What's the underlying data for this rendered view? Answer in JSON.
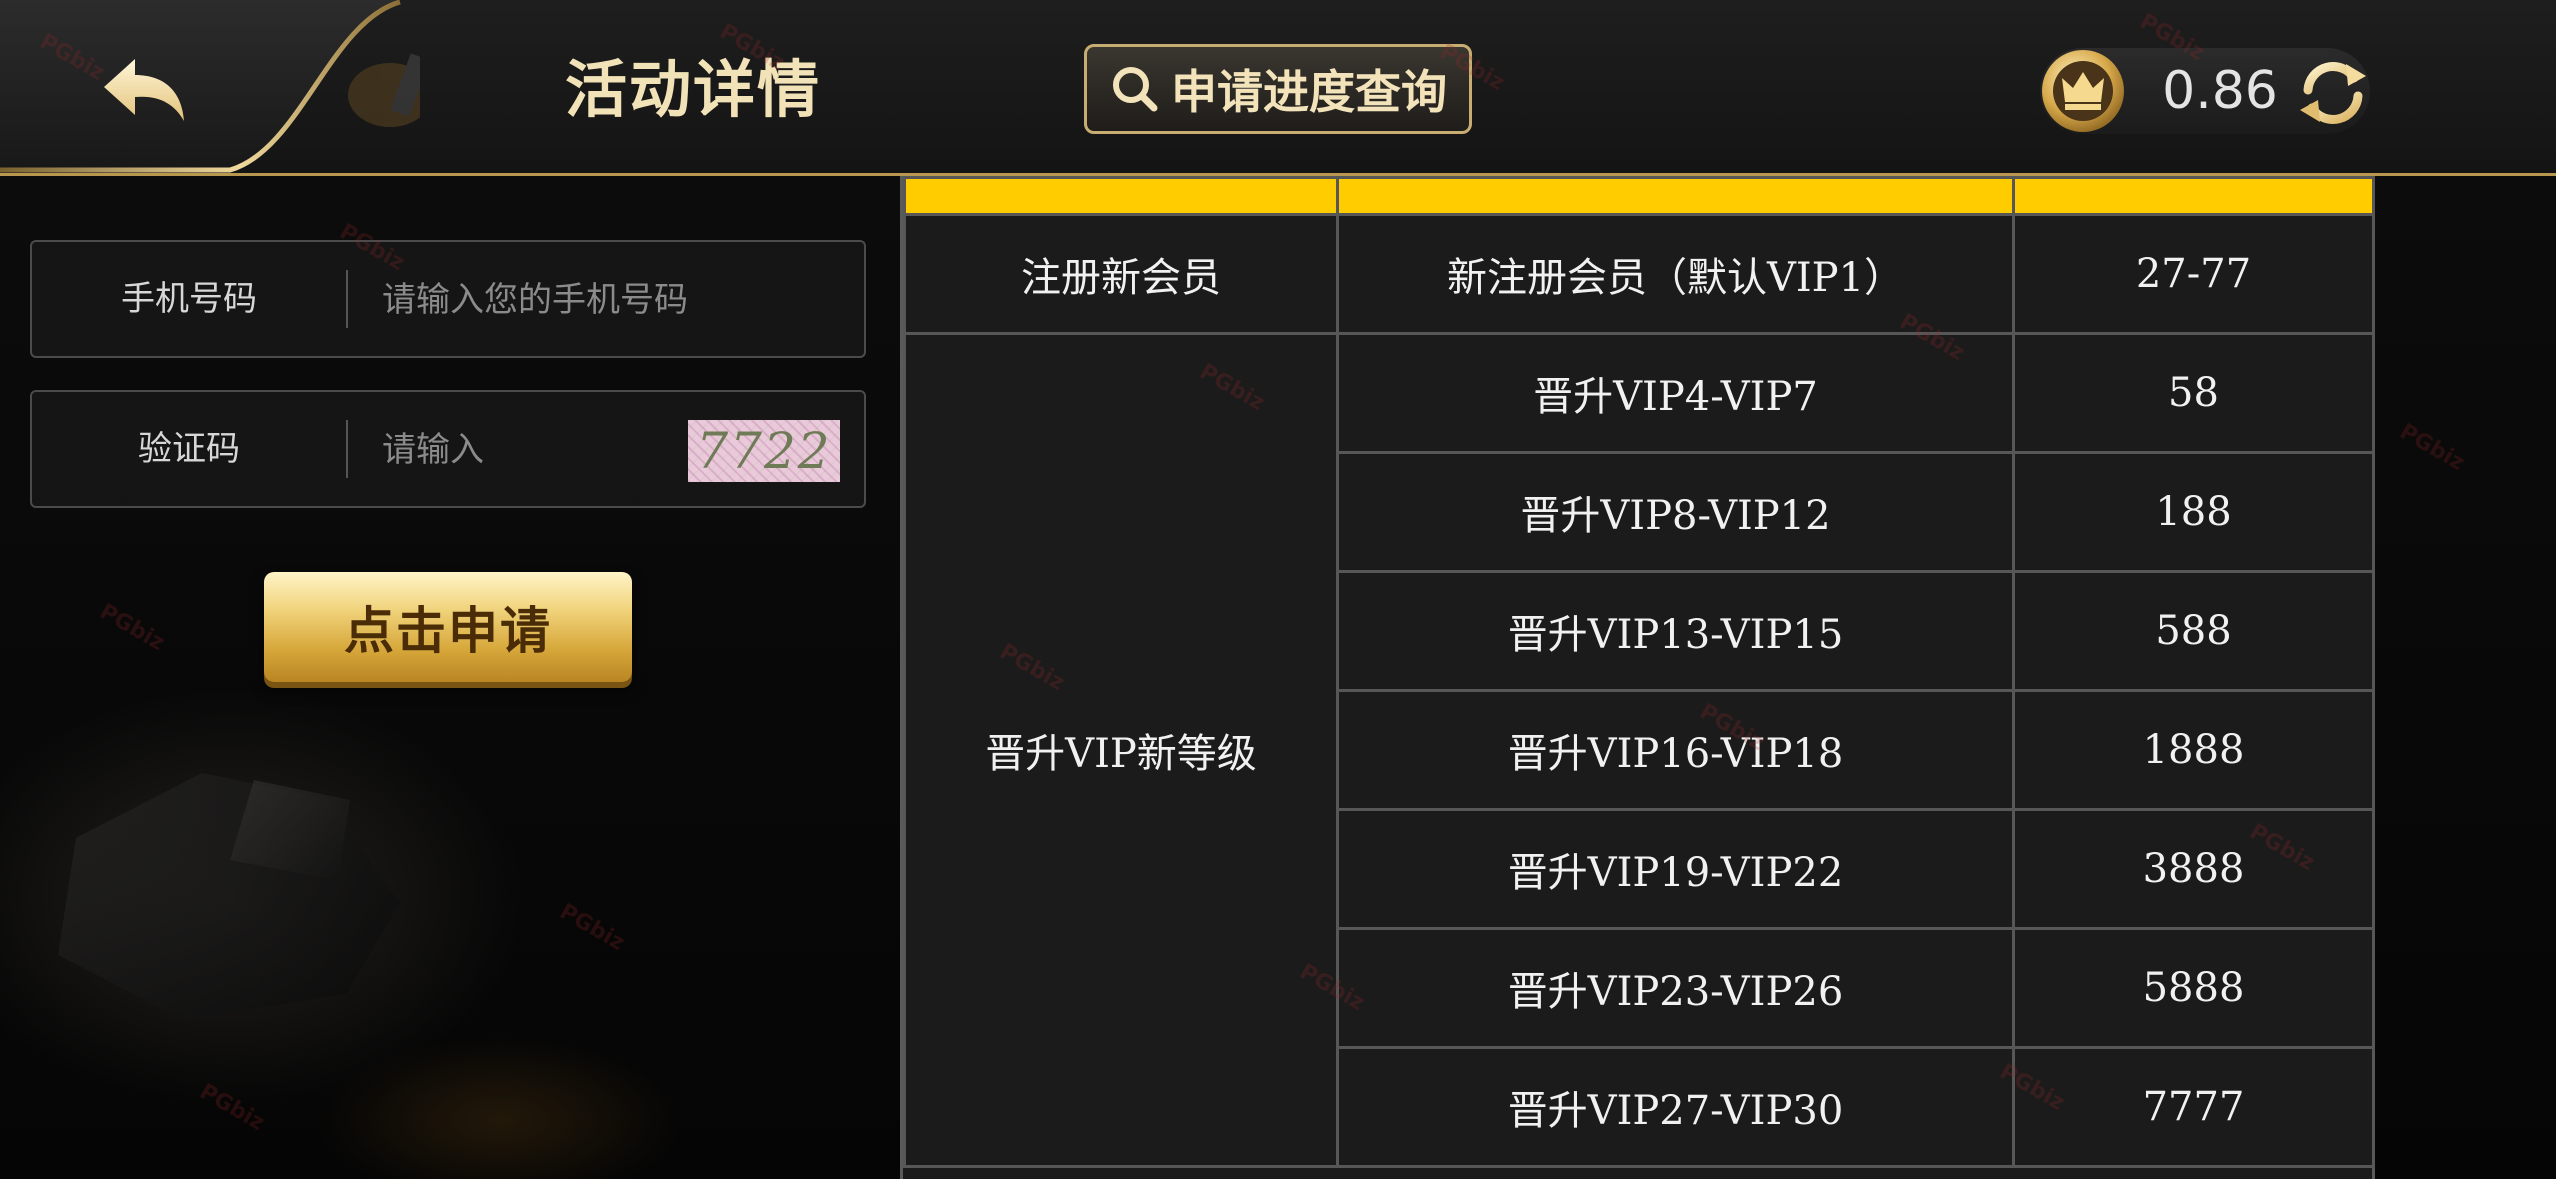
{
  "header": {
    "title": "活动详情",
    "progress_button": "申请进度查询",
    "balance": "0.86"
  },
  "form": {
    "phone_label": "手机号码",
    "phone_placeholder": "请输入您的手机号码",
    "captcha_label": "验证码",
    "captcha_placeholder": "请输入",
    "captcha_code": "7722",
    "submit_label": "点击申请"
  },
  "table": {
    "groups": [
      {
        "category": "注册新会员",
        "rows": [
          {
            "condition": "新注册会员（默认VIP1）",
            "reward": "27-77"
          }
        ]
      },
      {
        "category": "晋升VIP新等级",
        "rows": [
          {
            "condition": "晋升VIP4-VIP7",
            "reward": "58"
          },
          {
            "condition": "晋升VIP8-VIP12",
            "reward": "188"
          },
          {
            "condition": "晋升VIP13-VIP15",
            "reward": "588"
          },
          {
            "condition": "晋升VIP16-VIP18",
            "reward": "1888"
          },
          {
            "condition": "晋升VIP19-VIP22",
            "reward": "3888"
          },
          {
            "condition": "晋升VIP23-VIP26",
            "reward": "5888"
          },
          {
            "condition": "晋升VIP27-VIP30",
            "reward": "7777"
          }
        ]
      }
    ]
  },
  "watermark": {
    "text": "PG",
    "suffix": "biz"
  },
  "colors": {
    "accent_gold": "#f3e3bb",
    "table_header": "#ffcc00",
    "border_gold": "#b8974f"
  }
}
